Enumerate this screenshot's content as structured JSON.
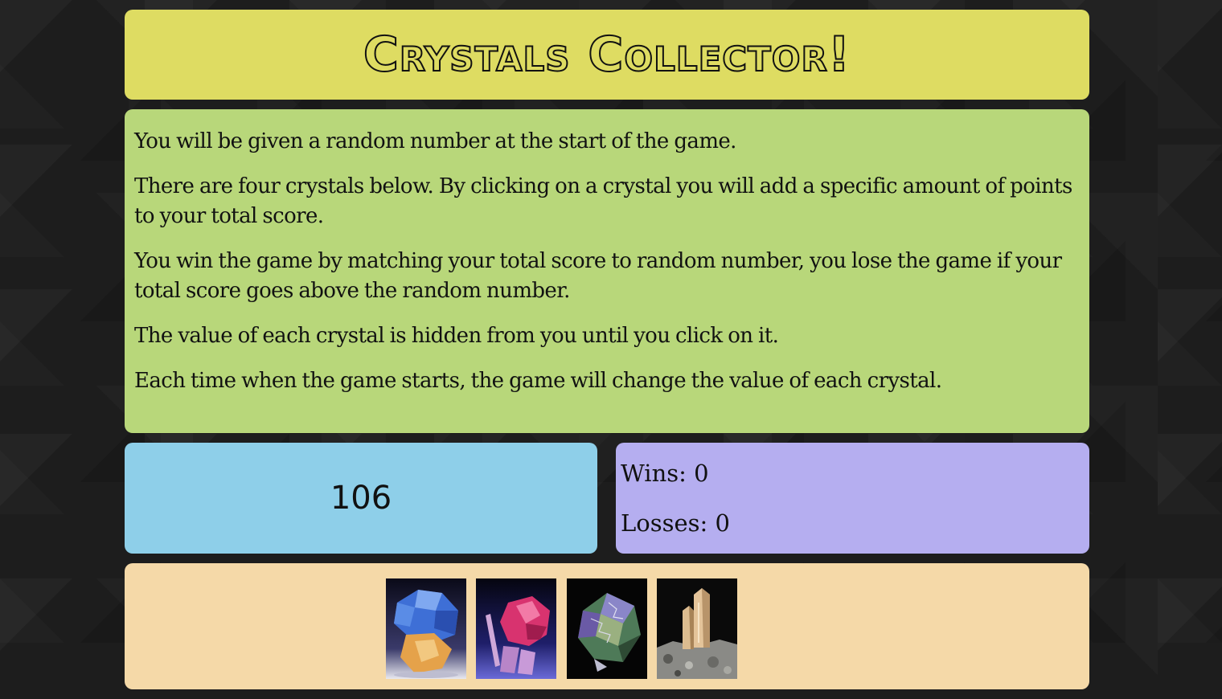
{
  "title": "Crystals Collector!",
  "instructions": [
    "You will be given a random number at the start of the game.",
    "There are four crystals below. By clicking on a crystal you will add a specific amount of points to your total score.",
    "You win the game by matching your total score to random number, you lose the game if your total score goes above the random number.",
    "The value of each crystal is hidden from you until you click on it.",
    "Each time when the game starts, the game will change the value of each crystal."
  ],
  "target_number": "106",
  "scores": {
    "wins_label": "Wins: 0",
    "losses_label": "Losses: 0"
  },
  "crystals": [
    {
      "name": "blue-crystal",
      "color": "#4a7fd8"
    },
    {
      "name": "pink-crystal",
      "color": "#d8336f"
    },
    {
      "name": "green-crystal",
      "color": "#5a8a5a"
    },
    {
      "name": "quartz-crystal",
      "color": "#d9b68a"
    }
  ],
  "colors": {
    "header": "#dedc62",
    "instructions": "#b8d77a",
    "target": "#8ecfe9",
    "scores": "#b5aef0",
    "crystals": "#f5d9a8"
  }
}
